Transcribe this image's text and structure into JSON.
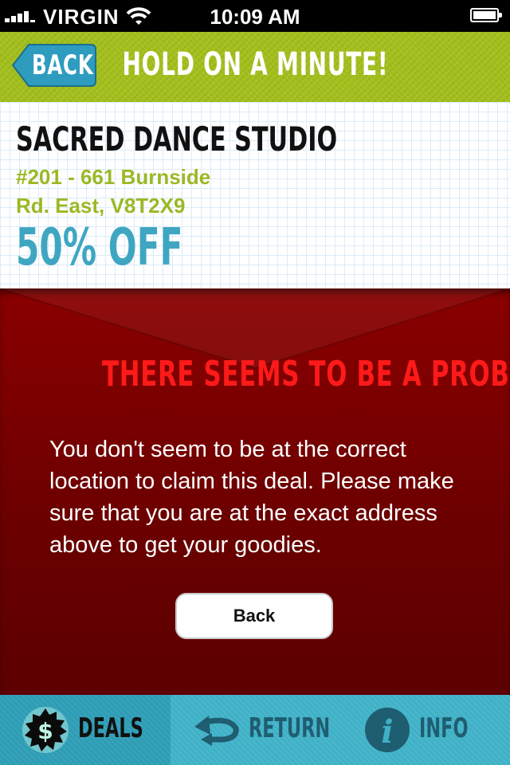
{
  "status_bar": {
    "carrier": "VIRGIN",
    "time": "10:09 AM"
  },
  "nav": {
    "back_label": "BACK",
    "title": "HOLD ON A MINUTE!"
  },
  "venue": {
    "name": "SACRED DANCE STUDIO",
    "address_line1": "#201 - 661 Burnside",
    "address_line2": "Rd. East, V8T2X9",
    "deal": "50% OFF"
  },
  "problem": {
    "title": "THERE SEEMS TO BE A PROBLEM.",
    "message": "You don't seem to be at the correct location to claim this deal. Please make sure that you are at the exact address above to get your goodies.",
    "back_button": "Back"
  },
  "tabs": [
    {
      "label": "DEALS",
      "icon": "dollar-badge-icon",
      "active": true
    },
    {
      "label": "RETURN",
      "icon": "return-arrow-icon",
      "active": false
    },
    {
      "label": "INFO",
      "icon": "info-icon",
      "active": false
    }
  ],
  "colors": {
    "nav_green": "#a2bf1b",
    "address_green": "#9bb826",
    "deal_blue": "#3fa6c2",
    "panel_red": "#7a0000",
    "title_red": "#ff1a1a",
    "tab_blue": "#3fb1c7",
    "tab_text": "#1f5d70"
  }
}
